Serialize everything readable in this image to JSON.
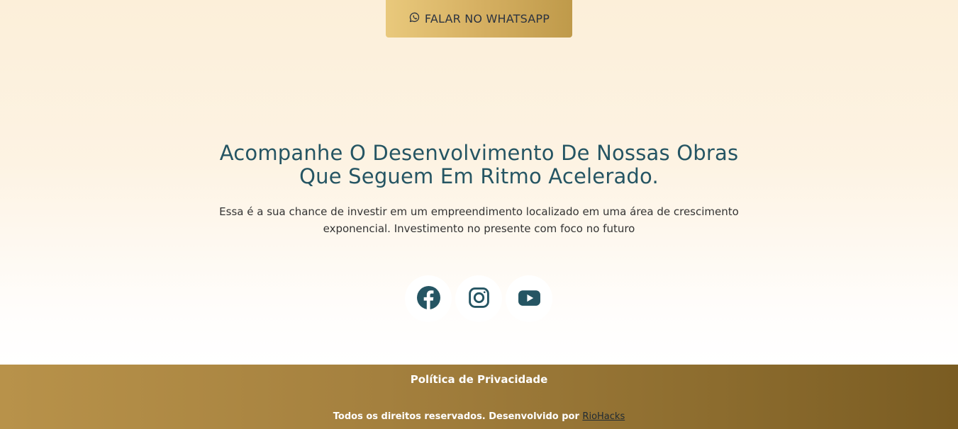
{
  "cta": {
    "whatsapp_label": "FALAR NO WHATSAPP",
    "icon": "whatsapp-icon"
  },
  "hero": {
    "headline_line1": "Acompanhe O Desenvolvimento De Nossas Obras",
    "headline_line2": "Que Seguem Em Ritmo Acelerado.",
    "subtext": "Essa é a sua chance de investir em um empreendimento localizado em uma área de crescimento exponencial. Investimento no presente com foco no futuro"
  },
  "socials": [
    {
      "name": "Facebook",
      "icon": "facebook-icon"
    },
    {
      "name": "Instagram",
      "icon": "instagram-icon"
    },
    {
      "name": "YouTube",
      "icon": "youtube-icon"
    }
  ],
  "footer": {
    "privacy_label": "Política de Privacidade",
    "copyright_text": "Todos os direitos reservados. Desenvolvido por ",
    "credit_link": "RioHacks"
  },
  "colors": {
    "accent_teal": "#255563",
    "gold": "#c9a454",
    "footer_dark": "#7a5c22"
  }
}
